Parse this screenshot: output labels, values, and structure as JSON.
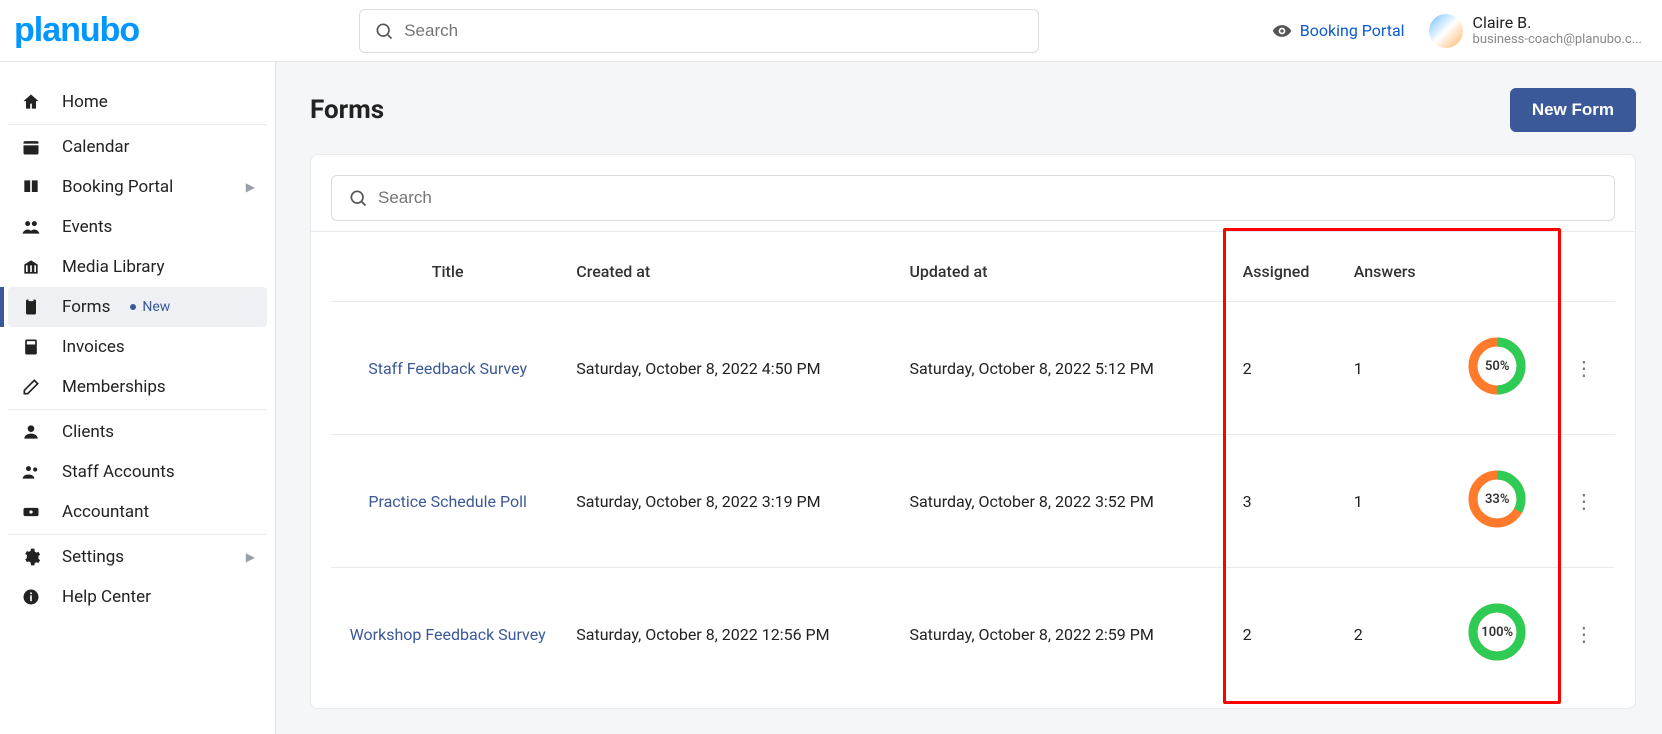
{
  "brand": "planubo",
  "header": {
    "search_placeholder": "Search",
    "booking_portal_label": "Booking Portal",
    "user_name": "Claire B.",
    "user_email": "business-coach@planubo.c..."
  },
  "sidebar": {
    "items": [
      {
        "label": "Home"
      },
      {
        "label": "Calendar"
      },
      {
        "label": "Booking Portal",
        "expandable": true
      },
      {
        "label": "Events"
      },
      {
        "label": "Media Library"
      },
      {
        "label": "Forms",
        "active": true,
        "badge": "New"
      },
      {
        "label": "Invoices"
      },
      {
        "label": "Memberships"
      },
      {
        "label": "Clients"
      },
      {
        "label": "Staff Accounts"
      },
      {
        "label": "Accountant"
      },
      {
        "label": "Settings",
        "expandable": true
      },
      {
        "label": "Help Center"
      }
    ]
  },
  "page": {
    "title": "Forms",
    "new_button": "New Form",
    "search_placeholder": "Search",
    "columns": {
      "title": "Title",
      "created": "Created at",
      "updated": "Updated at",
      "assigned": "Assigned",
      "answers": "Answers"
    },
    "rows": [
      {
        "title": "Staff Feedback Survey",
        "created": "Saturday, October 8, 2022 4:50 PM",
        "updated": "Saturday, October 8, 2022 5:12 PM",
        "assigned": "2",
        "answers": "1",
        "percent": 50,
        "percent_label": "50%"
      },
      {
        "title": "Practice Schedule Poll",
        "created": "Saturday, October 8, 2022 3:19 PM",
        "updated": "Saturday, October 8, 2022 3:52 PM",
        "assigned": "3",
        "answers": "1",
        "percent": 33,
        "percent_label": "33%"
      },
      {
        "title": "Workshop Feedback Survey",
        "created": "Saturday, October 8, 2022 12:56 PM",
        "updated": "Saturday, October 8, 2022 2:59 PM",
        "assigned": "2",
        "answers": "2",
        "percent": 100,
        "percent_label": "100%"
      }
    ]
  }
}
